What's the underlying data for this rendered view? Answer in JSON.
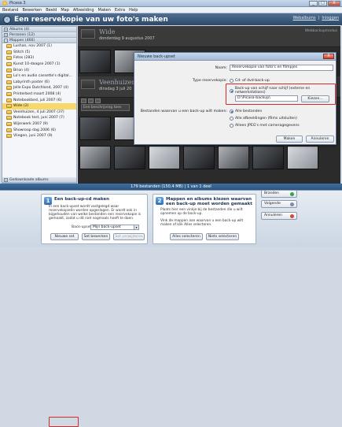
{
  "window": {
    "title": "Picasa 3",
    "controls": [
      "_",
      "□",
      "X"
    ]
  },
  "menu": [
    "Bestand",
    "Bewerken",
    "Beeld",
    "Map",
    "Afbeelding",
    "Maken",
    "Extra",
    "Help"
  ],
  "header": {
    "back_label": "‹",
    "title": "Een reservekopie van uw foto's maken",
    "link_account": "Webalbums",
    "link_signin": "Inloggen"
  },
  "sidebar": {
    "groups": [
      {
        "label": "Albums (4)",
        "toggle": "+"
      },
      {
        "label": "Personen (12)",
        "toggle": "+"
      },
      {
        "label": "Mappen (466)",
        "toggle": "−"
      }
    ],
    "items": [
      {
        "label": "Lushan, nov 2007 (1)"
      },
      {
        "label": "Stitch (5)"
      },
      {
        "label": "Fotos (283)"
      },
      {
        "label": "Kunst 10-daagse 2007 (1)"
      },
      {
        "label": "Brion (4)"
      },
      {
        "label": "Lo's en audio cassette's digital..."
      },
      {
        "label": "Labyrinth poster (6)"
      },
      {
        "label": "Jelle Expo Dutchland, 2007 (4)"
      },
      {
        "label": "Printerbed maart 2008 (4)"
      },
      {
        "label": "Notebookbed, juli 2007 (6)"
      },
      {
        "label": "Wide (2)",
        "selected": true
      },
      {
        "label": "Veenhuizen, 4 juli 2007 (37)"
      },
      {
        "label": "Notebook test, juni 2007 (7)"
      },
      {
        "label": "Wijerwerk 2007 (9)"
      },
      {
        "label": "Showroop dag 2006 (6)"
      },
      {
        "label": "Vliegen, juni 2007 (9)"
      }
    ],
    "bottom_group": {
      "label": "Gedownloade albums",
      "toggle": "+"
    }
  },
  "folders": [
    {
      "name": "Wide",
      "date": "donderdag 9 augustus 2007",
      "right_text": "Webbackupmodus"
    },
    {
      "name": "Veenhuizen,",
      "date": "dinsdag 3 juli 20",
      "description_placeholder": "Een beschrijving toev"
    }
  ],
  "status_bar": "179 bestanden (150,4 MB) | 1 van 1 deel",
  "panel_one": {
    "number": "1",
    "title": "Een back-up-cd maken",
    "text": "In een back-upset wordt vastgelegd waar reservekopieën worden opgeslagen. Er wordt ook in bijgehouden van welke bestanden een reservekopie is gemaakt, zodat u dit niet nogmaals hoeft te doen.",
    "set_label": "Back-upset:",
    "set_value": "Mijn back-upset",
    "btn_new": "Nieuwe set",
    "btn_edit": "Set bewerken",
    "btn_delete": "Set verwijderen"
  },
  "panel_two": {
    "number": "2",
    "title": "Mappen en albums kiezen waarvan een back-up moet worden gemaakt",
    "text1": "Plaats hier een vinkje bij de bestanden die u wilt opnemen op de back-up.",
    "text2": "Vink de mappen aan waarvan u een back-up wilt maken of klik Alles selecteren.",
    "btn_all": "Alles selecteren",
    "btn_none": "Niets selecteren"
  },
  "side_buttons": {
    "burn": "Branden",
    "disc": "Volgende",
    "cancel": "Annuleren"
  },
  "dialog": {
    "title": "Nieuwe back-upset",
    "close": "X",
    "name_label": "Naam:",
    "name_value": "Reservekopie van foto's en filmpjes",
    "type_label": "Type reservekopie:",
    "type_options": [
      {
        "label": "Cd- of dvd-back-up",
        "selected": false
      },
      {
        "label": "Back-up van schijf naar schijf (externe en netwerkstations)",
        "selected": true
      }
    ],
    "path_value": "D:\\Picasa-backup\\",
    "browse_button": "Kiezen...",
    "include_label": "Bestanden waarvan u een back-up wilt maken:",
    "include_options": [
      {
        "label": "Alle bestanden",
        "selected": true
      },
      {
        "label": "Alle afbeeldingen (films uitsluiten)",
        "selected": false
      },
      {
        "label": "Alleen JPEG's met cameragegevens",
        "selected": false
      }
    ],
    "create_button": "Maken",
    "cancel_button": "Annuleren"
  },
  "colors": {
    "highlight": "#d12b2b",
    "accent": "#2d6db2",
    "selected_folder": "#f7d96b"
  }
}
